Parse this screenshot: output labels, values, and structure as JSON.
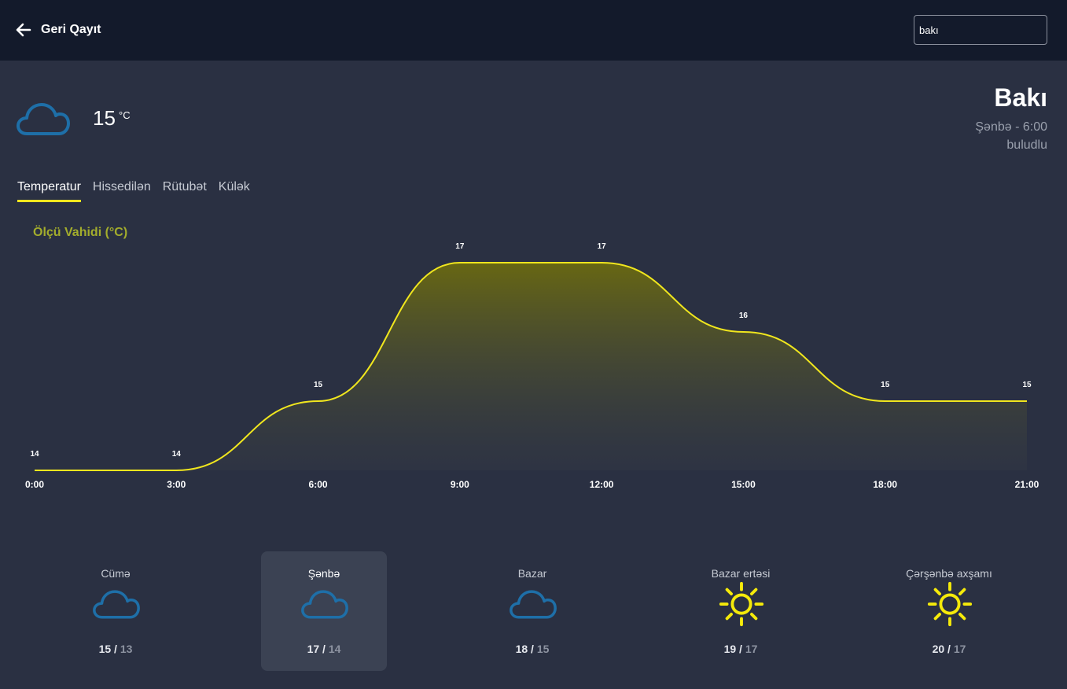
{
  "header": {
    "back_label": "Geri Qayıt",
    "search_value": "bakı"
  },
  "current": {
    "icon": "cloud-icon",
    "temp": "15",
    "unit": "°C",
    "city": "Bakı",
    "day_time": "Şənbə - 6:00",
    "condition": "buludlu"
  },
  "tabs": [
    {
      "label": "Temperatur",
      "active": true
    },
    {
      "label": "Hissedilən",
      "active": false
    },
    {
      "label": "Rütubət",
      "active": false
    },
    {
      "label": "Külək",
      "active": false
    }
  ],
  "unit_label": "Ölçü Vahidi (°C)",
  "colors": {
    "accent": "#f0e61e",
    "cloud": "#1e6fa8",
    "sun": "#f5ea0a",
    "unit_label": "#a3ad2c"
  },
  "chart_data": {
    "type": "area",
    "x": [
      "0:00",
      "3:00",
      "6:00",
      "9:00",
      "12:00",
      "15:00",
      "18:00",
      "21:00"
    ],
    "values": [
      14,
      14,
      15,
      17,
      17,
      16,
      15,
      15
    ],
    "ylim": [
      14,
      17
    ],
    "grid": false,
    "title": "",
    "xlabel": "",
    "ylabel": ""
  },
  "days": [
    {
      "name": "Cümə",
      "icon": "cloud-icon",
      "max": "15",
      "sep": " / ",
      "min": "13",
      "active": false
    },
    {
      "name": "Şənbə",
      "icon": "cloud-icon",
      "max": "17",
      "sep": " / ",
      "min": "14",
      "active": true
    },
    {
      "name": "Bazar",
      "icon": "cloud-icon",
      "max": "18",
      "sep": " / ",
      "min": "15",
      "active": false
    },
    {
      "name": "Bazar ertəsi",
      "icon": "sun-icon",
      "max": "19",
      "sep": " / ",
      "min": "17",
      "active": false
    },
    {
      "name": "Çərşənbə axşamı",
      "icon": "sun-icon",
      "max": "20",
      "sep": " / ",
      "min": "17",
      "active": false
    }
  ]
}
